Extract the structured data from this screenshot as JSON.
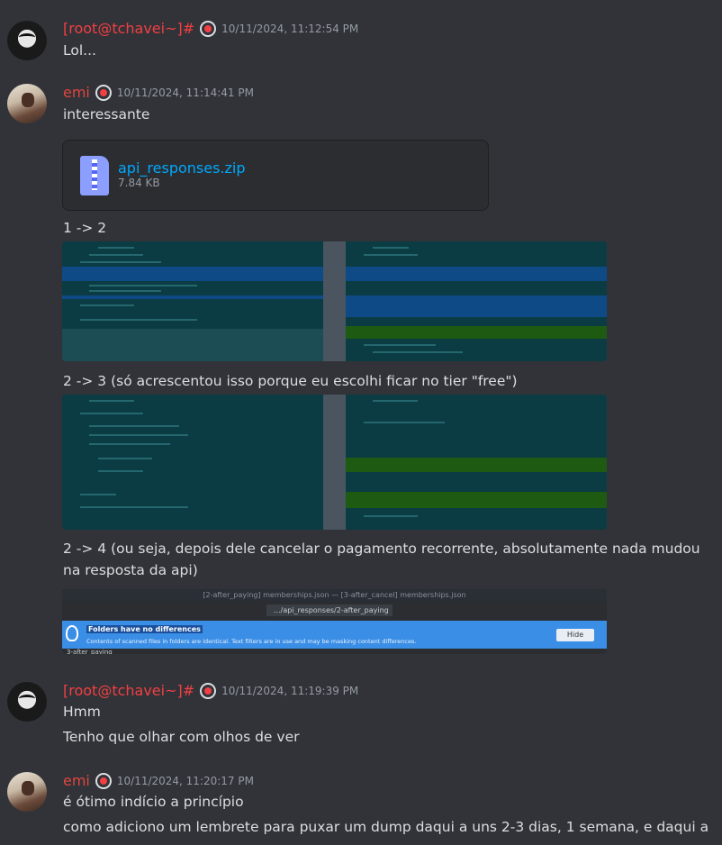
{
  "messages": [
    {
      "author": "[root@tchavei~]#",
      "timestamp": "10/11/2024, 11:12:54 PM",
      "lines": [
        "Lol..."
      ]
    },
    {
      "author": "emi",
      "timestamp": "10/11/2024, 11:14:41 PM",
      "lines": [
        "interessante",
        "1 -> 2",
        "2 -> 3 (só acrescentou isso porque eu escolhi ficar no tier \"free\")",
        "2 -> 4 (ou seja, depois dele cancelar o pagamento recorrente, absolutamente nada mudou",
        "na resposta da api)"
      ],
      "attachment": {
        "name": "api_responses.zip",
        "size": "7.84 KB",
        "icon": "zip-file-icon"
      },
      "folder_compare": {
        "window_title": "[2-after_paying] memberships.json — [3-after_cancel] memberships.json",
        "path": ".../api_responses/2-after_paying",
        "banner_title": "Folders have no differences",
        "banner_text": "Contents of scanned files in folders are identical. Text filters are in use and may be masking content differences.",
        "hide_label": "Hide",
        "footer": "3-after_paying"
      }
    },
    {
      "author": "[root@tchavei~]#",
      "timestamp": "10/11/2024, 11:19:39 PM",
      "lines": [
        "Hmm",
        "Tenho que olhar com olhos de ver"
      ]
    },
    {
      "author": "emi",
      "timestamp": "10/11/2024, 11:20:17 PM",
      "lines": [
        "é ótimo indício a princípio",
        "como adiciono um lembrete para puxar um dump daqui a uns 2-3 dias, 1 semana, e daqui a"
      ]
    }
  ],
  "colors": {
    "background": "#313338",
    "root_name": "#f23f43",
    "emi_name": "#e0453f",
    "link": "#00a8fc",
    "timestamp": "#949ba4"
  }
}
